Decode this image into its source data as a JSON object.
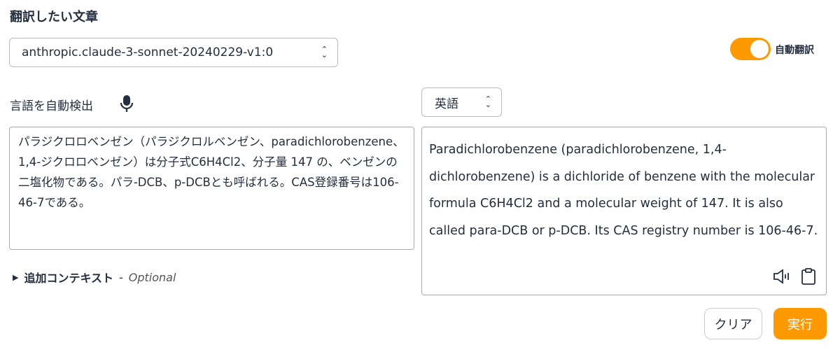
{
  "header": {
    "title": "翻訳したい文章"
  },
  "model_select": {
    "value": "anthropic.claude-3-sonnet-20240229-v1:0"
  },
  "auto_translate": {
    "label": "自動翻訳",
    "on": true,
    "color": "#ff9900"
  },
  "source": {
    "language": "言語を自動検出",
    "text": "パラジクロロベンゼン（パラジクロルベンゼン、paradichlorobenzene、1,4-ジクロロベンゼン）は分子式C6H4Cl2、分子量 147 の、ベンゼンの二塩化物である。パラ-DCB、p-DCBとも呼ばれる。CAS登録番号は106-46-7である。"
  },
  "target": {
    "language": "英語",
    "text": "Paradichlorobenzene (paradichlorobenzene, 1,4-dichlorobenzene) is a dichloride of benzene with the molecular formula C6H4Cl2 and a molecular weight of 147. It is also called para-DCB or p-DCB. Its CAS registry number is 106-46-7."
  },
  "context": {
    "label": "追加コンテキスト",
    "separator": "-",
    "optional": "Optional"
  },
  "buttons": {
    "clear": "クリア",
    "run": "実行"
  }
}
